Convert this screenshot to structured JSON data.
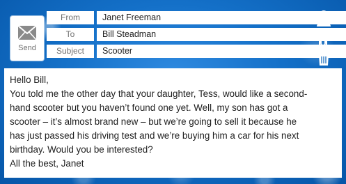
{
  "compose": {
    "send_label": "Send",
    "fields": [
      {
        "label": "From",
        "value": "Janet Freeman"
      },
      {
        "label": "To",
        "value": "Bill Steadman"
      },
      {
        "label": "Subject",
        "value": "Scooter"
      }
    ]
  },
  "icons": {
    "send": "envelope-icon",
    "contact": "person-icon",
    "attach": "paperclip-icon",
    "delete": "trash-icon"
  },
  "message": {
    "greeting": "Hello Bill,",
    "body_lines": [
      "You told me the other day that your daughter, Tess, would like a second-",
      "hand scooter but you haven’t found one yet. Well, my son has got a",
      "scooter – it’s almost brand new – but we’re going to sell it because he",
      "has just passed his driving test and we’re buying him a car for his next",
      "birthday. Would you be interested?"
    ],
    "signoff": "All the best, Janet"
  },
  "colors": {
    "background": "#0a62b8",
    "panel": "#ffffff",
    "label_text": "#6f6f6f",
    "icon": "#ffffff"
  }
}
